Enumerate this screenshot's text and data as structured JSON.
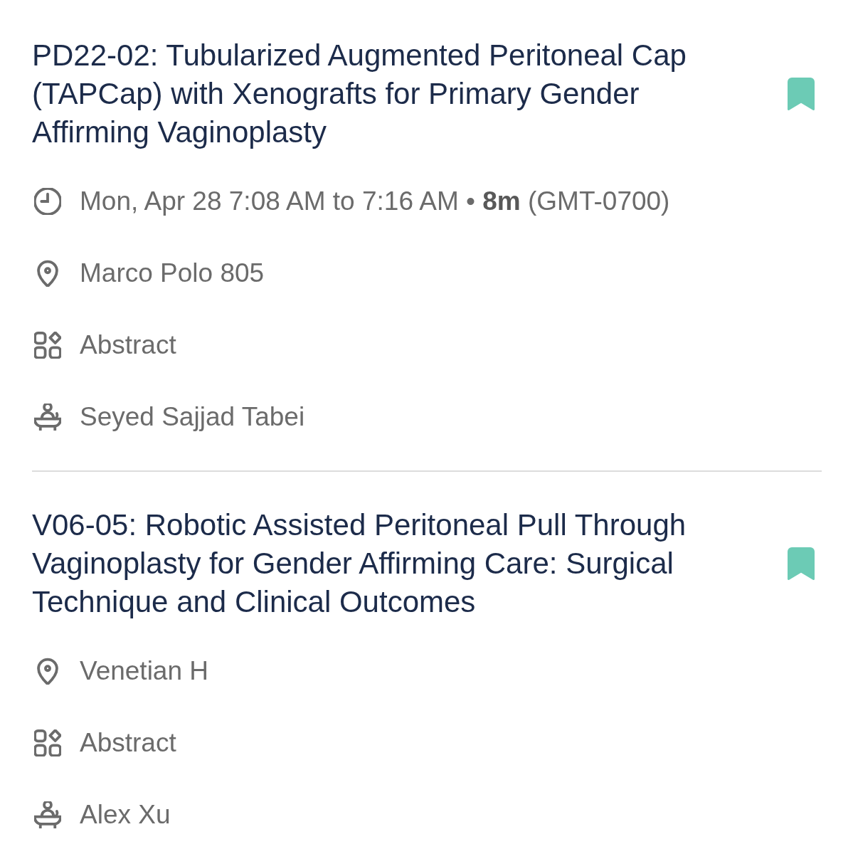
{
  "sessions": [
    {
      "title": "PD22-02: Tubularized Augmented Peritoneal Cap (TAPCap) with Xenografts for Primary Gender Affirming Vaginoplasty",
      "bookmarked": true,
      "details": [
        {
          "kind": "time",
          "text": "Mon, Apr 28 7:08 AM to 7:16 AM • **8m** (GMT-0700)"
        },
        {
          "kind": "location",
          "text": "Marco Polo 805"
        },
        {
          "kind": "type",
          "text": "Abstract"
        },
        {
          "kind": "speaker",
          "text": "Seyed Sajjad Tabei"
        }
      ]
    },
    {
      "title": "V06-05: Robotic Assisted Peritoneal Pull Through Vaginoplasty for Gender Affirming Care: Surgical Technique and Clinical Outcomes",
      "bookmarked": true,
      "details": [
        {
          "kind": "location",
          "text": "Venetian H"
        },
        {
          "kind": "type",
          "text": "Abstract"
        },
        {
          "kind": "speaker",
          "text": "Alex Xu"
        }
      ]
    }
  ]
}
